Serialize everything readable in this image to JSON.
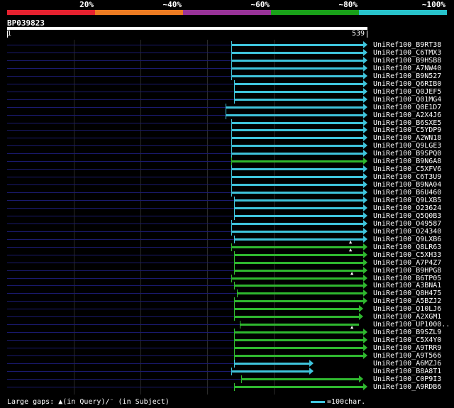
{
  "legend": {
    "segments": [
      {
        "color": "#e6212f"
      },
      {
        "color": "#ec7b22"
      },
      {
        "color": "#993399"
      },
      {
        "color": "#19a119"
      },
      {
        "color": "#28c3cc"
      }
    ],
    "labels": [
      "20%",
      "~40%",
      "~60%",
      "~80%",
      "~100%"
    ]
  },
  "query": {
    "id": "BP039823",
    "start": "1",
    "end": "539"
  },
  "colors": {
    "cyan": "#3fc4dc",
    "green": "#2fb82f",
    "pre": "#1a1a6e"
  },
  "hits": [
    {
      "name": "UniRef100_B9RT38",
      "color": "cyan",
      "arrow": true
    },
    {
      "name": "UniRef100_C6TMX3",
      "color": "cyan",
      "arrow": true
    },
    {
      "name": "UniRef100_B9HSB8",
      "color": "cyan",
      "arrow": true
    },
    {
      "name": "UniRef100_A7NW40",
      "color": "cyan",
      "arrow": true
    },
    {
      "name": "UniRef100_B9N527",
      "color": "cyan",
      "arrow": true
    },
    {
      "name": "UniRef100_Q6RIB0",
      "color": "cyan",
      "arrow": true
    },
    {
      "name": "UniRef100_Q0JEF5",
      "color": "cyan",
      "arrow": true
    },
    {
      "name": "UniRef100_Q01MG4",
      "color": "cyan",
      "arrow": true
    },
    {
      "name": "UniRef100_Q0E1D7",
      "color": "cyan",
      "arrow": true
    },
    {
      "name": "UniRef100_A2X4J6",
      "color": "cyan",
      "arrow": true
    },
    {
      "name": "UniRef100_B6SXE5",
      "color": "cyan",
      "arrow": true
    },
    {
      "name": "UniRef100_C5YDP9",
      "color": "cyan",
      "arrow": true
    },
    {
      "name": "UniRef100_A2WN18",
      "color": "cyan",
      "arrow": true
    },
    {
      "name": "UniRef100_Q9LGE3",
      "color": "cyan",
      "arrow": true
    },
    {
      "name": "UniRef100_B9SPQ0",
      "color": "cyan",
      "arrow": true
    },
    {
      "name": "UniRef100_B9N6A8",
      "color": "green",
      "arrow": true
    },
    {
      "name": "UniRef100_C5XFV6",
      "color": "cyan",
      "arrow": true
    },
    {
      "name": "UniRef100_C6T3U9",
      "color": "cyan",
      "arrow": true
    },
    {
      "name": "UniRef100_B9NA04",
      "color": "cyan",
      "arrow": true
    },
    {
      "name": "UniRef100_B6U460",
      "color": "cyan",
      "arrow": true
    },
    {
      "name": "UniRef100_Q9LXB5",
      "color": "cyan",
      "arrow": true
    },
    {
      "name": "UniRef100_O23624",
      "color": "cyan",
      "arrow": true
    },
    {
      "name": "UniRef100_Q5Q0B3",
      "color": "cyan",
      "arrow": true
    },
    {
      "name": "UniRef100_O49587",
      "color": "cyan",
      "arrow": true
    },
    {
      "name": "UniRef100_O24340",
      "color": "cyan",
      "arrow": true
    },
    {
      "name": "UniRef100_Q9LXB6",
      "color": "cyan",
      "arrow": true
    },
    {
      "name": "UniRef100_Q8LR63",
      "color": "green",
      "arrow": true,
      "gap": true
    },
    {
      "name": "UniRef100_C5XH33",
      "color": "green",
      "arrow": true,
      "gap": true
    },
    {
      "name": "UniRef100_A7P4Z7",
      "color": "green",
      "arrow": true
    },
    {
      "name": "UniRef100_B9HPG8",
      "color": "green",
      "arrow": true
    },
    {
      "name": "UniRef100_B6TP05",
      "color": "green",
      "arrow": true,
      "gap": true
    },
    {
      "name": "UniRef100_A3BNA1",
      "color": "green",
      "arrow": true
    },
    {
      "name": "UniRef100_Q8H475",
      "color": "green",
      "arrow": true
    },
    {
      "name": "UniRef100_A5BZJ2",
      "color": "green",
      "arrow": true
    },
    {
      "name": "UniRef100_Q10LJ6",
      "color": "green",
      "arrow": true
    },
    {
      "name": "UniRef100_A2XGM1",
      "color": "green",
      "arrow": true
    },
    {
      "name": "UniRef100_UP1000..",
      "color": "green",
      "arrow": false
    },
    {
      "name": "UniRef100_B9SZL9",
      "color": "green",
      "arrow": true,
      "gap": true
    },
    {
      "name": "UniRef100_C5X4Y0",
      "color": "green",
      "arrow": true
    },
    {
      "name": "UniRef100_A9TRR9",
      "color": "green",
      "arrow": true
    },
    {
      "name": "UniRef100_A9T566",
      "color": "green",
      "arrow": true
    },
    {
      "name": "UniRef100_A6MZJ6",
      "color": "cyan",
      "arrow": true
    },
    {
      "name": "UniRef100_B8A8T1",
      "color": "cyan",
      "arrow": true
    },
    {
      "name": "UniRef100_C0P9I3",
      "color": "green",
      "arrow": true
    },
    {
      "name": "UniRef100_A9RDB6",
      "color": "green",
      "arrow": true
    }
  ],
  "footer": {
    "gaps_text": "Large gaps: ▲(in Query)/⁻ (in Subject)",
    "scale_text": "=100char."
  }
}
